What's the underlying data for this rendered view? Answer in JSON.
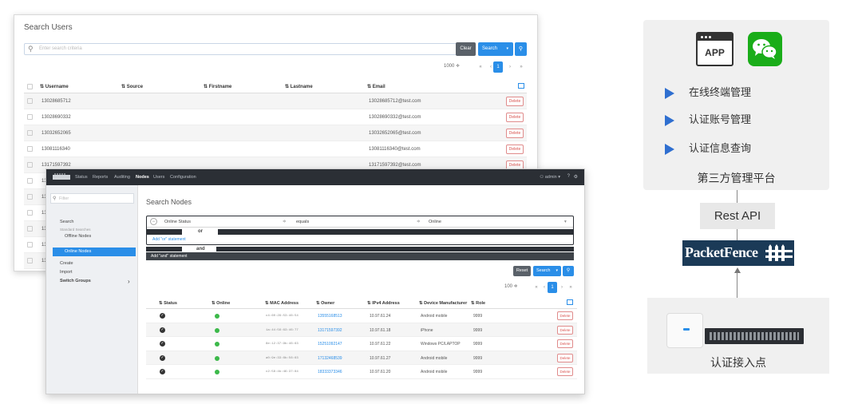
{
  "users_window": {
    "title": "Search Users",
    "search_placeholder": "Enter search criteria",
    "clear_label": "Clear",
    "search_label": "Search",
    "page_size": "1000 ≑",
    "pager": [
      "«",
      "‹",
      "1",
      "›",
      "»"
    ],
    "columns": [
      "Username",
      "Source",
      "Firstname",
      "Lastname",
      "Email"
    ],
    "rows": [
      {
        "username": "13028685712",
        "email": "13028685712@test.com"
      },
      {
        "username": "13028690332",
        "email": "13028690332@test.com"
      },
      {
        "username": "13032652065",
        "email": "13032652065@test.com"
      },
      {
        "username": "13081116340",
        "email": "13081116340@test.com"
      },
      {
        "username": "13171597392",
        "email": "13171597392@test.com"
      },
      {
        "username": "13",
        "email": ""
      },
      {
        "username": "13",
        "email": ""
      },
      {
        "username": "13",
        "email": ""
      },
      {
        "username": "13",
        "email": ""
      },
      {
        "username": "13",
        "email": ""
      },
      {
        "username": "13",
        "email": ""
      }
    ],
    "delete_label": "Delete"
  },
  "nodes_window": {
    "nav": [
      "Status",
      "Reports",
      "Auditing",
      "Nodes",
      "Users",
      "Configuration"
    ],
    "nav_active": "Nodes",
    "admin_label": "admin ▾",
    "sidebar": {
      "filter_placeholder": "Filter",
      "search": "Search",
      "saved_searches": "Standard Searches",
      "offline_nodes": "Offline Nodes",
      "online_nodes": "Online Nodes",
      "create": "Create",
      "import": "Import",
      "switch_groups": "Switch Groups",
      "chevron": "›"
    },
    "title": "Search Nodes",
    "filter": {
      "field": "Online Status",
      "operator": "equals",
      "value": "Online",
      "or_label": "or",
      "add_or": "Add \"or\" statement",
      "and_label": "and",
      "add_and": "Add \"and\" statement"
    },
    "reset_label": "Reset",
    "search_label": "Search",
    "page_size": "100 ≑",
    "pager": [
      "«",
      "‹",
      "1",
      "›",
      "»"
    ],
    "columns": [
      "Status",
      "Online",
      "MAC Address",
      "Owner",
      "IPv4 Address",
      "Device Manufacturer",
      "Role"
    ],
    "rows": [
      {
        "mac": "c4:60:29:53:46:54",
        "owner": "13555168513",
        "ip": "10.97.61.24",
        "manufacturer": "Android mobile",
        "role": "9999"
      },
      {
        "mac": "1a:44:56:63:46:77",
        "owner": "13171597392",
        "ip": "10.97.61.18",
        "manufacturer": "iPhone",
        "role": "9999"
      },
      {
        "mac": "8e:12:37:9b:46:63",
        "owner": "15251092147",
        "ip": "10.97.61.22",
        "manufacturer": "Windows PC/LAPTOP",
        "role": "9999"
      },
      {
        "mac": "a0:9e:33:6b:56:63",
        "owner": "17132468539",
        "ip": "10.97.61.27",
        "manufacturer": "Android mobile",
        "role": "9999"
      },
      {
        "mac": "c2:58:4b:46:37:84",
        "owner": "18333373346",
        "ip": "10.97.61.20",
        "manufacturer": "Android mobile",
        "role": "9999"
      }
    ],
    "delete_label": "Delete"
  },
  "diagram": {
    "app_label": "APP",
    "features": [
      "在线终端管理",
      "认证账号管理",
      "认证信息查询"
    ],
    "platform_label": "第三方管理平台",
    "rest_api": "Rest API",
    "packetfence": "PacketFence",
    "access_label": "认证接入点"
  },
  "colors": {
    "accent_blue": "#2a8ee8",
    "nav_dark": "#2b2f35",
    "delete_red": "#d9534f",
    "online_green": "#3cb94a",
    "wechat_green": "#1aad19",
    "arrow_blue": "#2f6fd0"
  }
}
